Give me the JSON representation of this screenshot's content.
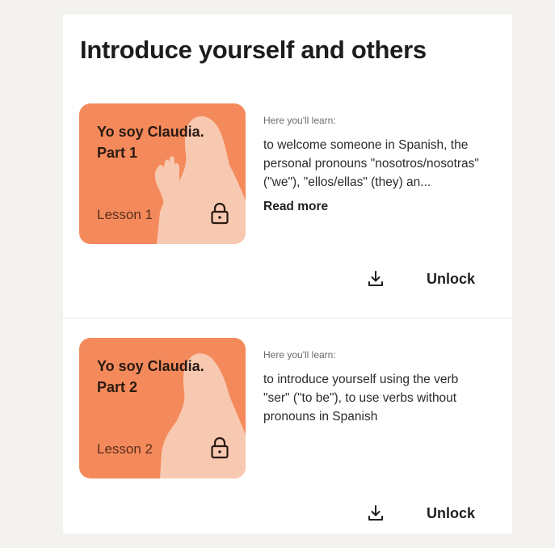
{
  "section": {
    "title": "Introduce yourself and others"
  },
  "lessons": [
    {
      "title": "Yo soy Claudia. Part 1",
      "lesson_label": "Lesson 1",
      "caption": "Here you'll learn:",
      "description": "to welcome someone in Spanish, the personal pronouns \"nosotros/nosotras\" (\"we\"), \"ellos/ellas\" (they) an...",
      "read_more": "Read more",
      "unlock_label": "Unlock",
      "locked": true
    },
    {
      "title": "Yo soy Claudia. Part 2",
      "lesson_label": "Lesson 2",
      "caption": "Here you'll learn:",
      "description": "to introduce yourself using the verb \"ser\" (\"to be\"), to use verbs without pronouns in Spanish",
      "unlock_label": "Unlock",
      "locked": true
    }
  ],
  "icons": {
    "lock": "lock-icon",
    "download": "download-icon"
  },
  "colors": {
    "card_background": "#f48a5b",
    "illustration": "#f8c9b1",
    "text_primary": "#1f1f1f",
    "text_secondary": "#6a6a6a"
  }
}
